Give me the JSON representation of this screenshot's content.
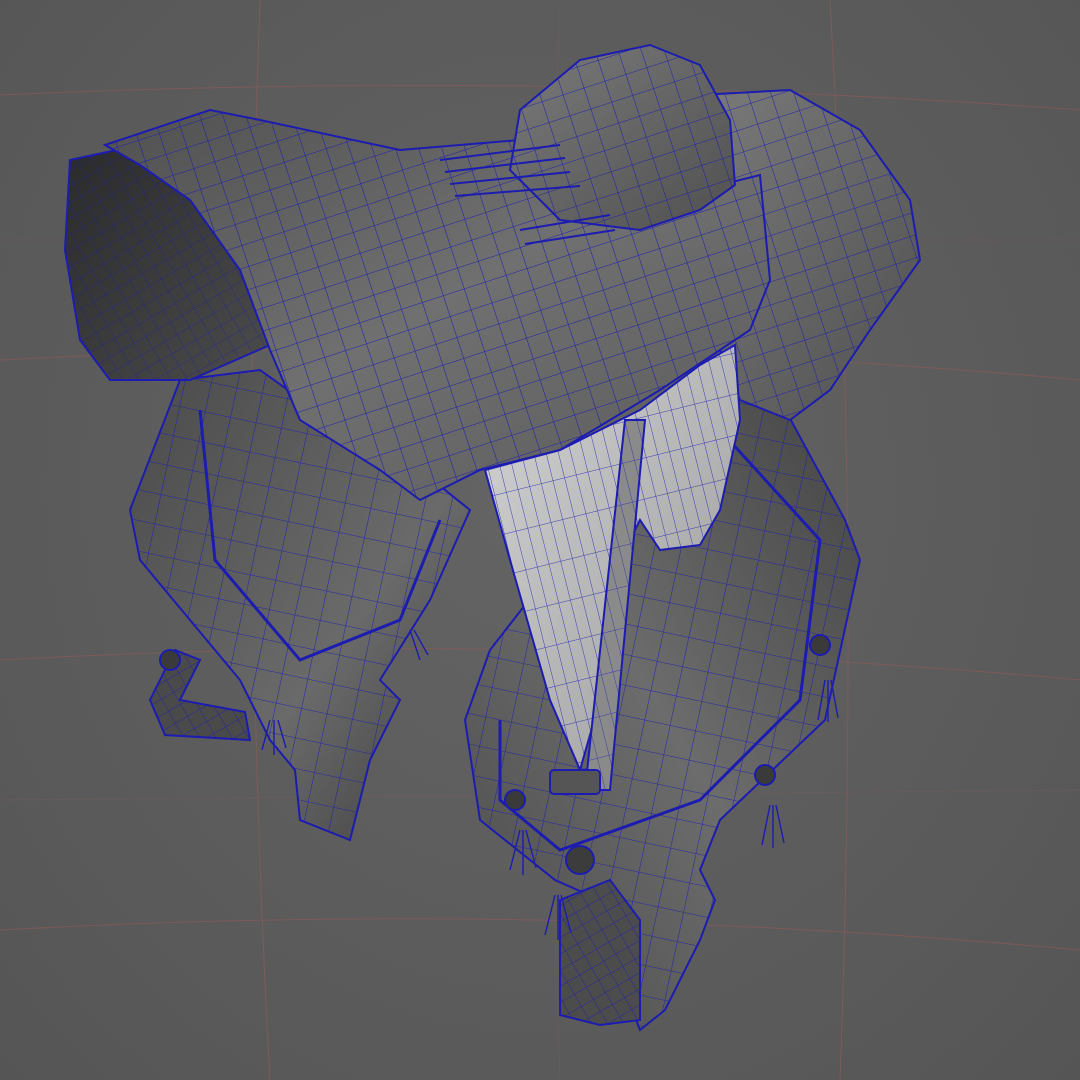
{
  "viewport": {
    "display_mode": "wireframe-on-shaded",
    "model": "saddle",
    "grid_visible": true
  },
  "colors": {
    "background": "#5d5d5d",
    "grid_line": "#8a5a5a",
    "wireframe": "#1c1cb0",
    "shaded_dark": "#3a3a3a",
    "shaded_mid": "#6e6e6e",
    "shaded_light": "#bdbdbd"
  }
}
